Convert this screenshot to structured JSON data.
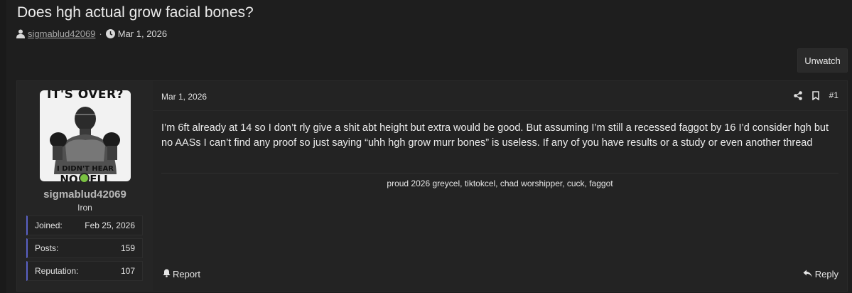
{
  "thread": {
    "title": "Does hgh actual grow facial bones?",
    "author": "sigmablud42069",
    "separator": "·",
    "date": "Mar 1, 2026",
    "unwatch_label": "Unwatch"
  },
  "post": {
    "user": {
      "avatar_text_top": "IT'S OVER?",
      "avatar_text_bottom": "I DIDN'T HEAR",
      "avatar_text_bottom2": "NO BELL",
      "username": "sigmablud42069",
      "rank": "Iron",
      "stats": [
        {
          "label": "Joined:",
          "value": "Feb 25, 2026"
        },
        {
          "label": "Posts:",
          "value": "159"
        },
        {
          "label": "Reputation:",
          "value": "107"
        }
      ]
    },
    "date": "Mar 1, 2026",
    "number": "#1",
    "body": "I’m 6ft already at 14 so I don’t rly give a shit abt height but extra would be good. But assuming I’m still a recessed faggot by 16 I’d consider hgh but no AASs I can’t find any proof so just saying “uhh hgh grow murr bones” is useless. If any of you have results or a study or even another thread",
    "signature": "proud 2026 greycel, tiktokcel, chad worshipper, cuck, faggot",
    "report_label": "Report",
    "reply_label": "Reply"
  },
  "icons": {
    "user": "user-icon",
    "clock": "clock-icon",
    "share": "share-icon",
    "bookmark": "bookmark-icon",
    "report": "bell-icon",
    "reply": "reply-arrow-icon"
  },
  "colors": {
    "background": "#1e1e1e",
    "post_bg": "#232323",
    "stat_accent": "#5a62c6",
    "online": "#7ac142"
  }
}
